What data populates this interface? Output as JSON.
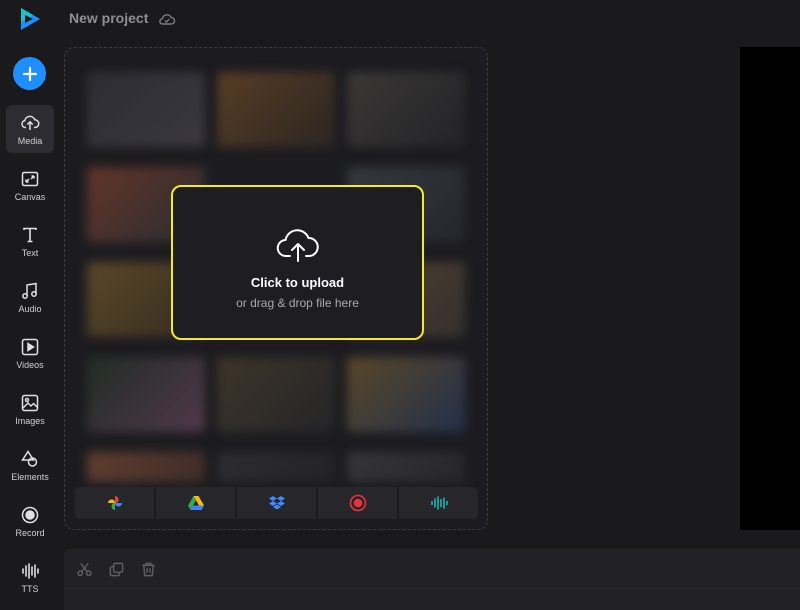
{
  "header": {
    "project_title": "New project",
    "cloud_icon": "cloud-sync-icon",
    "logo_icon": "play-logo-icon"
  },
  "sidebar": {
    "add_icon": "plus-icon",
    "items": [
      {
        "label": "Media",
        "icon": "upload-cloud-icon",
        "active": true
      },
      {
        "label": "Canvas",
        "icon": "resize-icon"
      },
      {
        "label": "Text",
        "icon": "text-t-icon"
      },
      {
        "label": "Audio",
        "icon": "music-note-icon"
      },
      {
        "label": "Videos",
        "icon": "play-square-icon"
      },
      {
        "label": "Images",
        "icon": "image-icon"
      },
      {
        "label": "Elements",
        "icon": "shapes-icon"
      },
      {
        "label": "Record",
        "icon": "record-icon"
      },
      {
        "label": "TTS",
        "icon": "waveform-icon"
      }
    ]
  },
  "upload": {
    "title": "Click to upload",
    "subtitle": "or drag & drop file here",
    "icon": "cloud-upload-icon"
  },
  "sources": [
    "google-photos-icon",
    "google-drive-icon",
    "dropbox-icon",
    "record-icon",
    "audio-wave-icon"
  ],
  "timeline": {
    "tools": [
      "scissors-icon",
      "duplicate-icon",
      "trash-icon"
    ]
  },
  "colors": {
    "accent": "#1f8fff",
    "highlight": "#f5ea2a",
    "background": "#1a1a1d",
    "logo_teal": "#19c3c9",
    "logo_blue": "#1f8fff"
  }
}
